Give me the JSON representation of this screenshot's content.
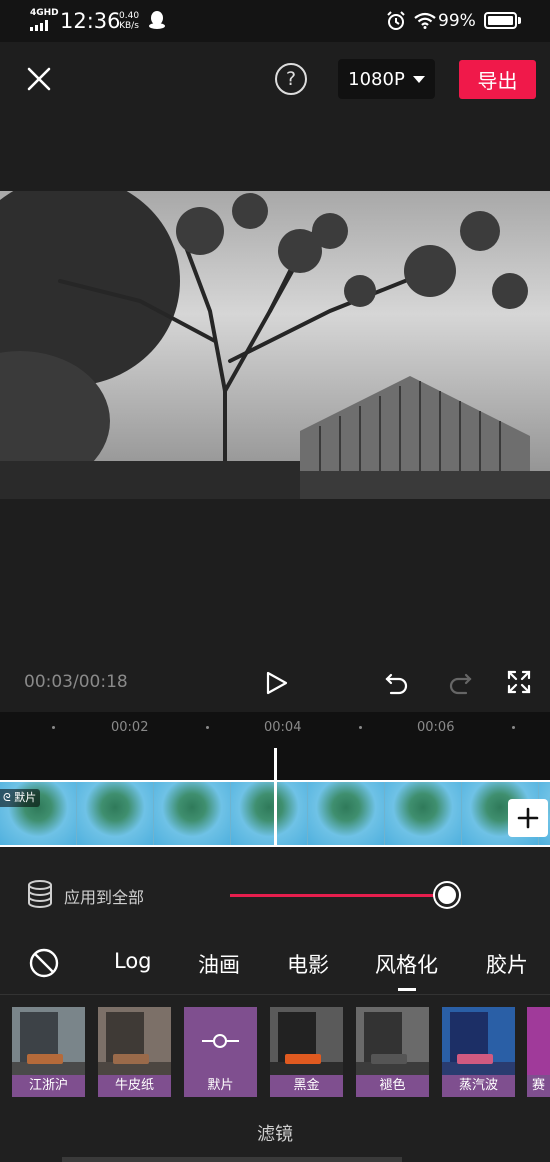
{
  "status_bar": {
    "network": "4GHD",
    "time": "12:36",
    "speed_value": "0.40",
    "speed_unit": "KB/s",
    "battery": "99%"
  },
  "top_bar": {
    "resolution": "1080P",
    "export_label": "导出",
    "help_symbol": "?"
  },
  "player": {
    "timecode": "00:03/00:18"
  },
  "timeline": {
    "ticks": [
      "00:02",
      "00:04",
      "00:06"
    ],
    "clip_tag": "默片"
  },
  "filter_panel": {
    "apply_all_label": "应用到全部",
    "intensity": 1.0,
    "categories": [
      "Log",
      "油画",
      "电影",
      "风格化",
      "胶片"
    ],
    "selected_category": "风格化",
    "filters": [
      "江浙沪",
      "牛皮纸",
      "默片",
      "黑金",
      "褪色",
      "蒸汽波",
      "赛"
    ],
    "selected_filter": "默片",
    "title": "滤镜"
  },
  "colors": {
    "accent_red": "#f0194a",
    "slider_red": "#e61e4d",
    "filter_purple": "#7f4f8f",
    "background": "#1e1e1e"
  }
}
